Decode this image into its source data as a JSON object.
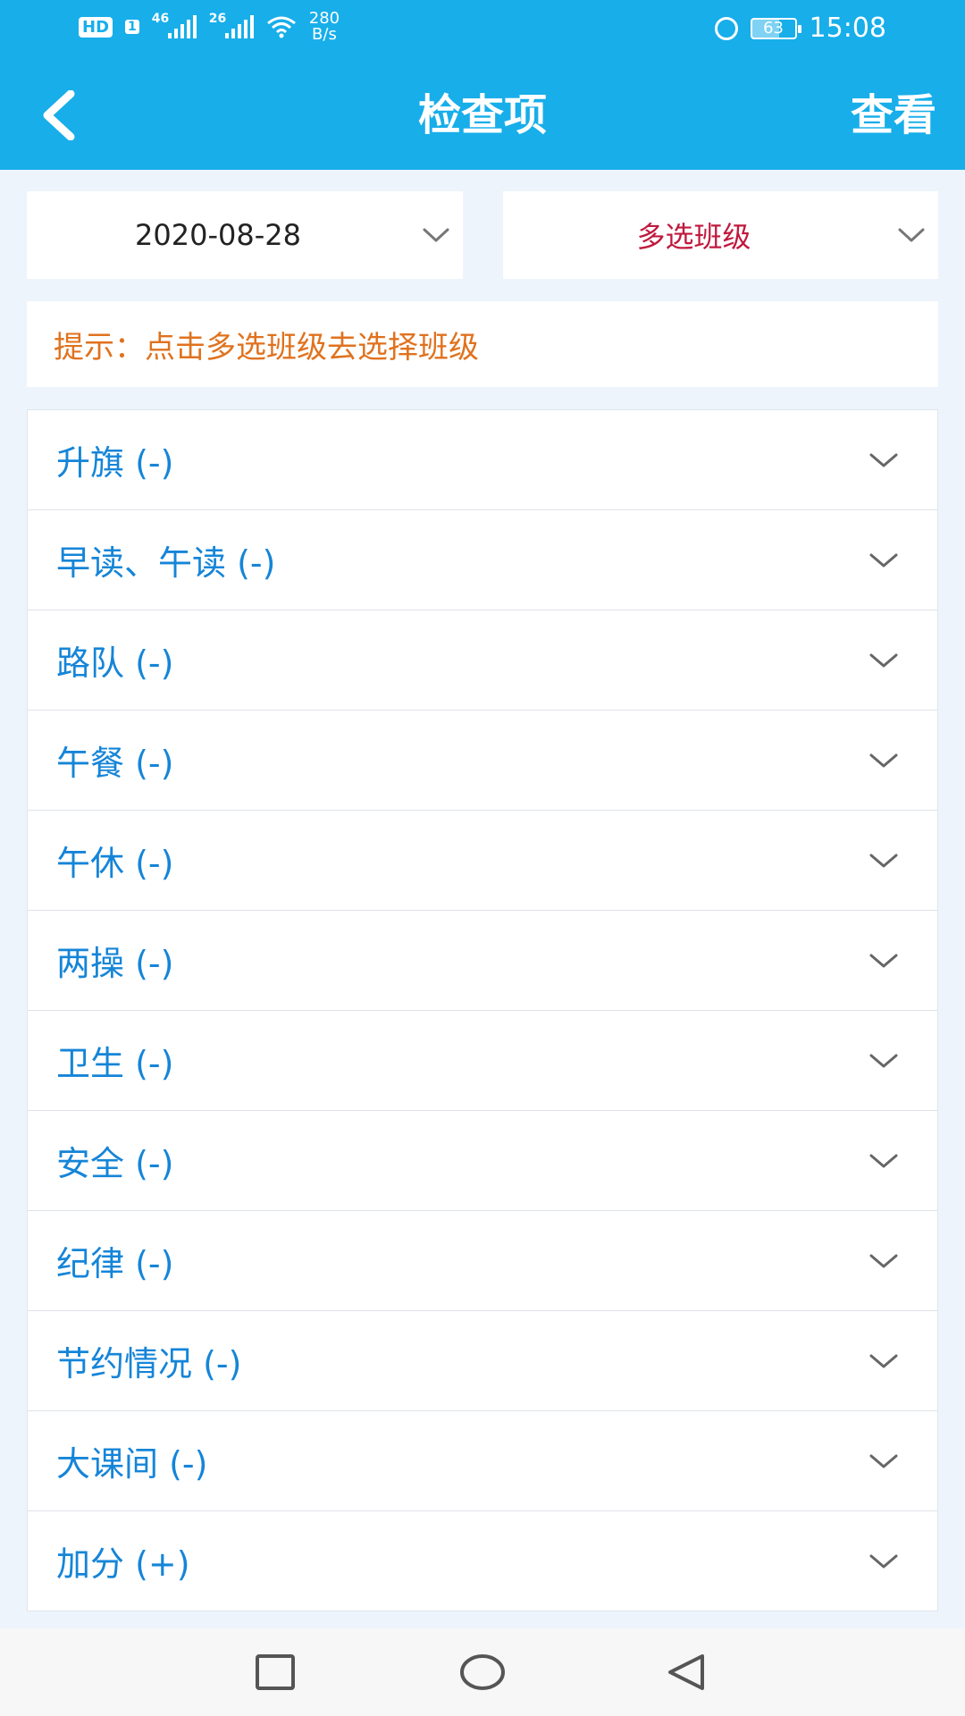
{
  "status_bar": {
    "hd": "HD",
    "sim": "1",
    "net1": "46",
    "net2": "26",
    "speed_value": "280",
    "speed_unit": "B/s",
    "battery": "63",
    "battery_level": 0.63,
    "time": "15:08"
  },
  "header": {
    "title": "检查项",
    "action": "查看"
  },
  "filters": {
    "date": "2020-08-28",
    "class_select": "多选班级"
  },
  "hint": "提示：点击多选班级去选择班级",
  "items": [
    {
      "label": "升旗 (-)"
    },
    {
      "label": "早读、午读 (-)"
    },
    {
      "label": "路队 (-)"
    },
    {
      "label": "午餐 (-)"
    },
    {
      "label": "午休 (-)"
    },
    {
      "label": "两操 (-)"
    },
    {
      "label": "卫生 (-)"
    },
    {
      "label": "安全 (-)"
    },
    {
      "label": "纪律 (-)"
    },
    {
      "label": "节约情况 (-)"
    },
    {
      "label": "大课间 (-)"
    },
    {
      "label": "加分 (+)"
    }
  ],
  "icons": {
    "back": "chevron-left-icon",
    "expand": "chevron-down-icon",
    "nav_recent": "square-icon",
    "nav_home": "circle-icon",
    "nav_back": "triangle-left-icon"
  },
  "colors": {
    "primary": "#17aeea",
    "item_text": "#1585d8",
    "hint_text": "#e0721e",
    "class_text": "#c0193e"
  }
}
